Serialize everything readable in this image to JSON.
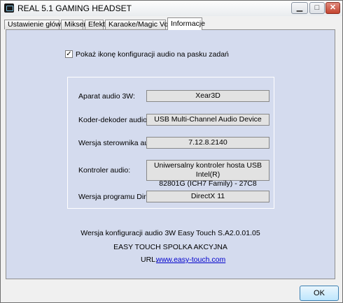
{
  "window": {
    "title": "REAL 5.1 GAMING HEADSET"
  },
  "tabs": [
    {
      "label": "Ustawienie główne"
    },
    {
      "label": "Mikser"
    },
    {
      "label": "Efekt"
    },
    {
      "label": "Karaoke/Magic Voice"
    },
    {
      "label": "Informacje",
      "active": true
    }
  ],
  "info": {
    "tray_checkbox": {
      "label": "Pokaż ikonę konfiguracji audio na pasku zadań",
      "checked": true,
      "mark": "✓"
    },
    "rows": [
      {
        "label": "Aparat audio 3W:",
        "value": "Xear3D"
      },
      {
        "label": "Koder-dekoder audio:",
        "value": "USB Multi-Channel Audio Device"
      },
      {
        "label": "Wersja sterownika audio:",
        "value": "7.12.8.2140"
      },
      {
        "label": "Kontroler audio:",
        "value_line1": "Uniwersalny kontroler hosta USB Intel(R)",
        "value_line2": "82801G (ICH7 Family) - 27C8"
      },
      {
        "label": "Wersja programu DirectX:",
        "value": "DirectX 11"
      }
    ],
    "footer": {
      "version": "Wersja konfiguracji audio 3W Easy Touch S.A2.0.01.05",
      "company": "EASY TOUCH SPOLKA AKCYJNA",
      "url_label": "URL:",
      "url": "www.easy-touch.com"
    }
  },
  "buttons": {
    "ok": "OK",
    "minimize": "▁",
    "maximize": "□",
    "close": "✕"
  },
  "colors": {
    "panel_bg": "#d4dbee",
    "link": "#0000cc",
    "close_btn": "#c4442f"
  }
}
